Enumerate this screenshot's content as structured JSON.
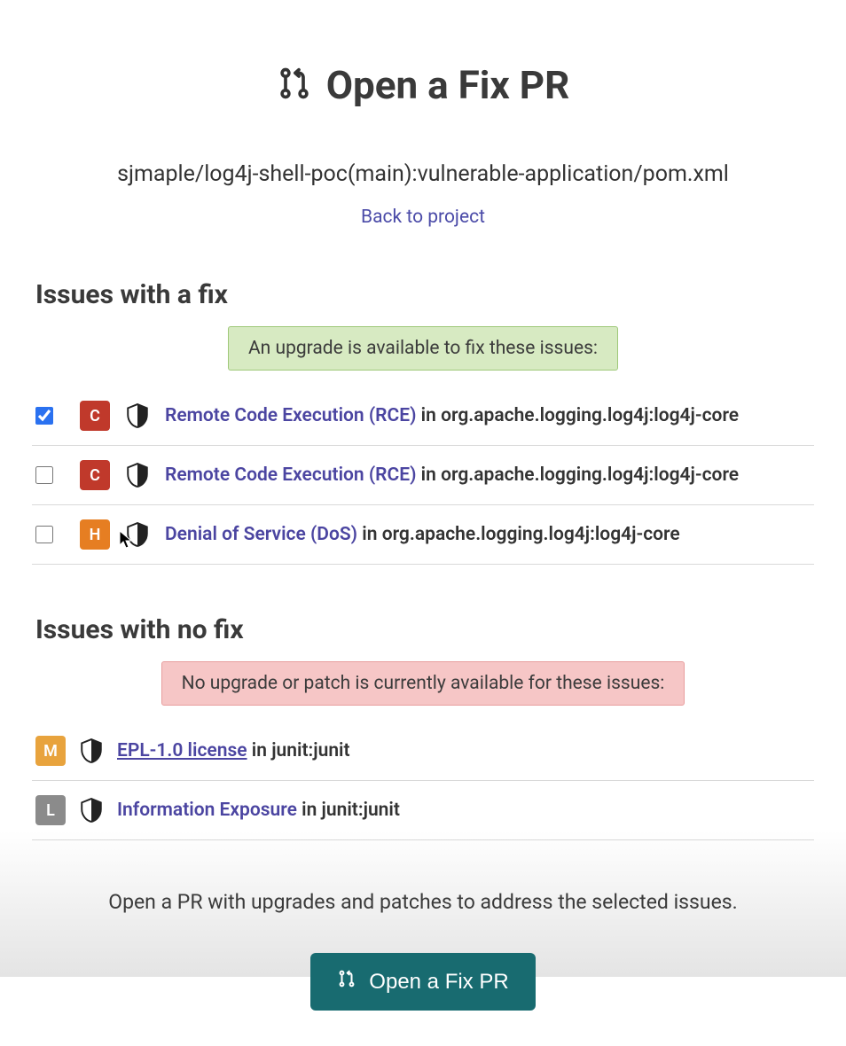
{
  "header": {
    "title": "Open a Fix PR",
    "breadcrumb": "sjmaple/log4j-shell-poc(main):vulnerable-application/pom.xml",
    "back_link": "Back to project"
  },
  "sections": {
    "with_fix": {
      "heading": "Issues with a fix",
      "banner": "An upgrade is available to fix these issues:"
    },
    "no_fix": {
      "heading": "Issues with no fix",
      "banner": "No upgrade or patch is currently available for these issues:"
    }
  },
  "fixable_issues": [
    {
      "checked": true,
      "severity": "C",
      "title": "Remote Code Execution (RCE)",
      "in_word": "in",
      "package": "org.apache.logging.log4j:log4j-core"
    },
    {
      "checked": false,
      "severity": "C",
      "title": "Remote Code Execution (RCE)",
      "in_word": "in",
      "package": "org.apache.logging.log4j:log4j-core"
    },
    {
      "checked": false,
      "severity": "H",
      "title": "Denial of Service (DoS)",
      "in_word": "in",
      "package": "org.apache.logging.log4j:log4j-core"
    }
  ],
  "nofix_issues": [
    {
      "severity": "M",
      "title": "EPL-1.0 license",
      "underlined": true,
      "in_word": "in",
      "package": "junit:junit"
    },
    {
      "severity": "L",
      "title": "Information Exposure",
      "underlined": false,
      "in_word": "in",
      "package": "junit:junit"
    }
  ],
  "footer": {
    "helper": "Open a PR with upgrades and patches to address the selected issues.",
    "cta_label": "Open a Fix PR"
  },
  "colors": {
    "severity_C": "#c0392b",
    "severity_H": "#e67e22",
    "severity_M": "#e8a33d",
    "severity_L": "#8b8b8b",
    "link": "#4b45a1",
    "cta_bg": "#186b70"
  }
}
